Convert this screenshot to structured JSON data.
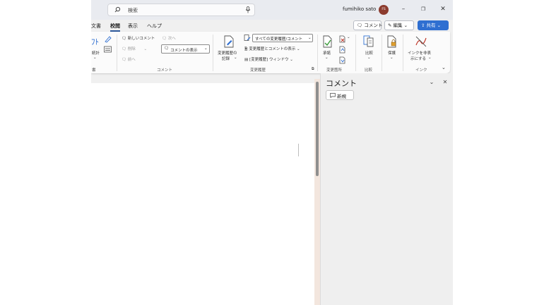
{
  "search": {
    "label": "検索"
  },
  "user": {
    "name": "fumihiko sato",
    "initials": "FS"
  },
  "window_controls": {
    "minimize": "–",
    "restore": "❐",
    "close": "✕"
  },
  "tabs": [
    {
      "label": "文書",
      "active": false
    },
    {
      "label": "校閲",
      "active": true
    },
    {
      "label": "表示",
      "active": false
    },
    {
      "label": "ヘルプ",
      "active": false
    }
  ],
  "top_buttons": {
    "comment": "コメント",
    "edit": "編集",
    "share": "共有"
  },
  "ribbon": {
    "left_partial": {
      "line1": "ﾌﾄ",
      "line2": "統計",
      "line3": "⌄",
      "group": "書"
    },
    "comments": {
      "new": "新しいコメント",
      "delete": "削除",
      "previous": "前へ",
      "next": "次へ",
      "show": "コメントの表示",
      "group": "コメント"
    },
    "tracking": {
      "record_line1": "変更履歴の",
      "record_line2": "記録",
      "markup_select": "すべての変更履歴/コメント",
      "show_markup": "変更履歴とコメントの表示",
      "pane": "[変更履歴] ウィンドウ",
      "group": "変更履歴"
    },
    "changes": {
      "accept": "承諾",
      "group": "変更箇所"
    },
    "compare": {
      "label": "比較",
      "group": "比較"
    },
    "protect": {
      "label": "保護"
    },
    "ink": {
      "line1": "インクを非表",
      "line2": "示にする",
      "group": "インク"
    }
  },
  "comments_pane": {
    "title": "コメント",
    "new_button": "新規"
  },
  "colors": {
    "accent": "#2f6fd1",
    "active_tab": "#2b579a",
    "avatar": "#8c3b2e",
    "titlebar": "#e9ebf0"
  }
}
